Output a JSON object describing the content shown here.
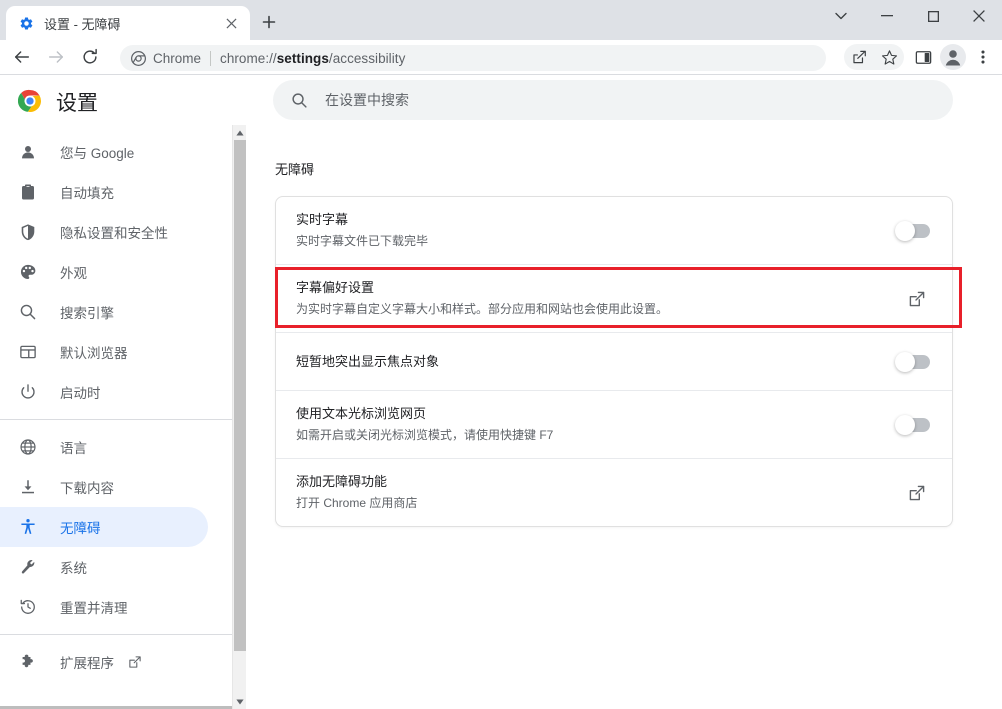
{
  "window": {
    "controls": [
      {
        "name": "tab-search-button",
        "glyph": "chevron-down"
      },
      {
        "name": "minimize-button",
        "glyph": "minimize"
      },
      {
        "name": "maximize-button",
        "glyph": "maximize"
      },
      {
        "name": "close-button",
        "glyph": "close"
      }
    ]
  },
  "tab": {
    "title": "设置 - 无障碍",
    "favicon": "gear-icon",
    "close_label": "×",
    "newtab_label": "+"
  },
  "toolbar": {
    "back": "back-arrow-icon",
    "forward": "forward-arrow-icon",
    "reload": "reload-icon",
    "omnibox": {
      "chip_label": "Chrome",
      "url_prefix": "chrome://",
      "url_bold": "settings",
      "url_suffix": "/accessibility"
    },
    "right_icons": [
      "share-icon",
      "star-icon",
      "side-panel-icon",
      "profile-avatar-icon",
      "more-menu-icon"
    ]
  },
  "settings": {
    "app_title": "设置",
    "logo": "chrome-logo-icon",
    "search": {
      "placeholder": "在设置中搜索",
      "value": "",
      "icon": "search-icon"
    }
  },
  "sidebar": {
    "group1": [
      {
        "label": "您与 Google",
        "icon": "person-icon",
        "active": false
      },
      {
        "label": "自动填充",
        "icon": "clipboard-icon",
        "active": false
      },
      {
        "label": "隐私设置和安全性",
        "icon": "shield-icon",
        "active": false
      },
      {
        "label": "外观",
        "icon": "palette-icon",
        "active": false
      },
      {
        "label": "搜索引擎",
        "icon": "search-icon",
        "active": false
      },
      {
        "label": "默认浏览器",
        "icon": "browser-window-icon",
        "active": false
      },
      {
        "label": "启动时",
        "icon": "power-icon",
        "active": false
      }
    ],
    "group2": [
      {
        "label": "语言",
        "icon": "globe-icon",
        "active": false
      },
      {
        "label": "下载内容",
        "icon": "download-icon",
        "active": false
      },
      {
        "label": "无障碍",
        "icon": "accessibility-icon",
        "active": true
      },
      {
        "label": "系统",
        "icon": "wrench-icon",
        "active": false
      },
      {
        "label": "重置并清理",
        "icon": "history-restore-icon",
        "active": false
      }
    ],
    "group3": [
      {
        "label": "扩展程序",
        "icon": "puzzle-icon",
        "active": false,
        "external": true
      }
    ],
    "active_accent": "#1a73e8",
    "active_bg": "#e8f0fe"
  },
  "main": {
    "section_title": "无障碍",
    "rows": [
      {
        "title": "实时字幕",
        "subtitle": "实时字幕文件已下载完毕",
        "control": "toggle",
        "toggle_on": false,
        "highlighted": false
      },
      {
        "title": "字幕偏好设置",
        "subtitle": "为实时字幕自定义字幕大小和样式。部分应用和网站也会使用此设置。",
        "control": "external-link",
        "highlighted": true
      },
      {
        "title": "短暂地突出显示焦点对象",
        "subtitle": "",
        "control": "toggle",
        "toggle_on": false,
        "highlighted": false
      },
      {
        "title": "使用文本光标浏览网页",
        "subtitle": "如需开启或关闭光标浏览模式，请使用快捷键 F7",
        "control": "toggle",
        "toggle_on": false,
        "highlighted": false
      },
      {
        "title": "添加无障碍功能",
        "subtitle": "打开 Chrome 应用商店",
        "control": "external-link",
        "highlighted": false
      }
    ],
    "highlight_color": "#e8202a"
  }
}
